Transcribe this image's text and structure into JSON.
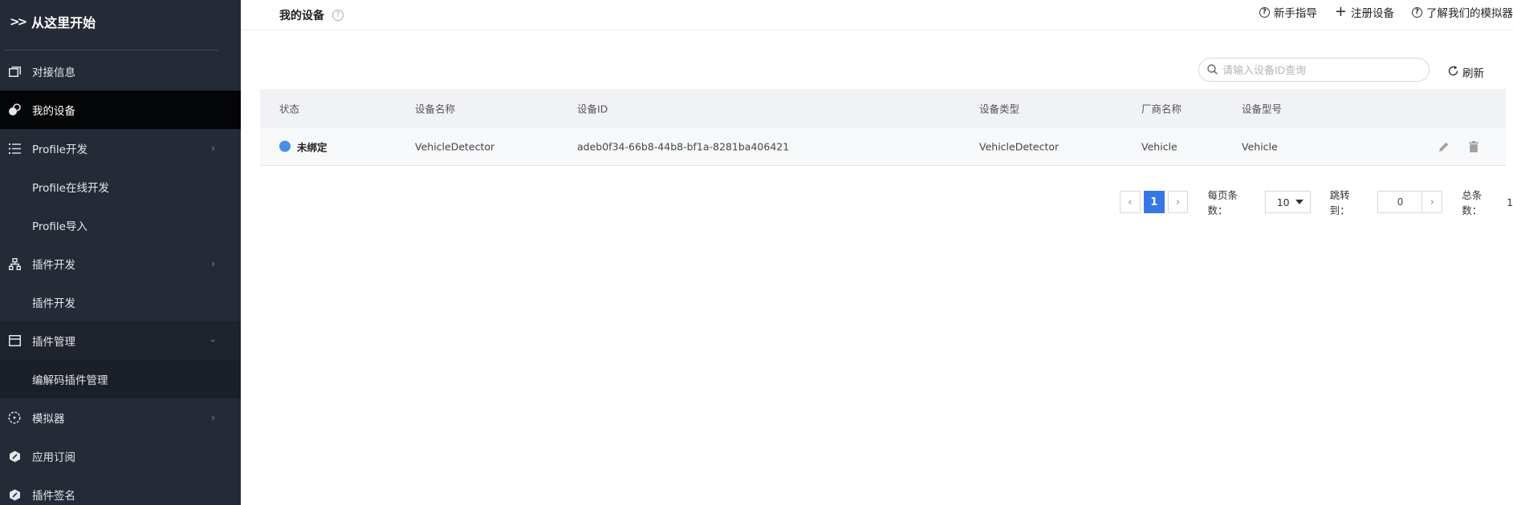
{
  "sidebar": {
    "header": "从这里开始",
    "items": [
      {
        "label": "对接信息"
      },
      {
        "label": "我的设备"
      },
      {
        "label": "Profile开发"
      },
      {
        "label": "Profile在线开发"
      },
      {
        "label": "Profile导入"
      },
      {
        "label": "插件开发"
      },
      {
        "label": "插件开发"
      },
      {
        "label": "插件管理"
      },
      {
        "label": "编解码插件管理"
      },
      {
        "label": "模拟器"
      },
      {
        "label": "应用订阅"
      },
      {
        "label": "插件签名"
      }
    ]
  },
  "topbar": {
    "title": "我的设备",
    "actions": {
      "guide": "新手指导",
      "register": "注册设备",
      "simulator": "了解我们的模拟器"
    }
  },
  "search": {
    "placeholder": "请输入设备ID查询",
    "value": ""
  },
  "refresh_label": "刷新",
  "table": {
    "headers": [
      "状态",
      "设备名称",
      "设备ID",
      "设备类型",
      "厂商名称",
      "设备型号"
    ],
    "rows": [
      {
        "status": "未绑定",
        "name": "VehicleDetector",
        "id": "adeb0f34-66b8-44b8-bf1a-8281ba406421",
        "type": "VehicleDetector",
        "vendor": "Vehicle",
        "model": "Vehicle"
      }
    ]
  },
  "pagination": {
    "current_page": "1",
    "per_page_label": "每页条数：",
    "per_page_value": "10",
    "jump_label": "跳转到：",
    "jump_value": "0",
    "total_label": "总条数：",
    "total_value": "1"
  },
  "colors": {
    "sidebar_bg": "#252b36",
    "active_item_bg": "#040507",
    "accent": "#3578e5",
    "status_dot": "#4a8fe7"
  }
}
